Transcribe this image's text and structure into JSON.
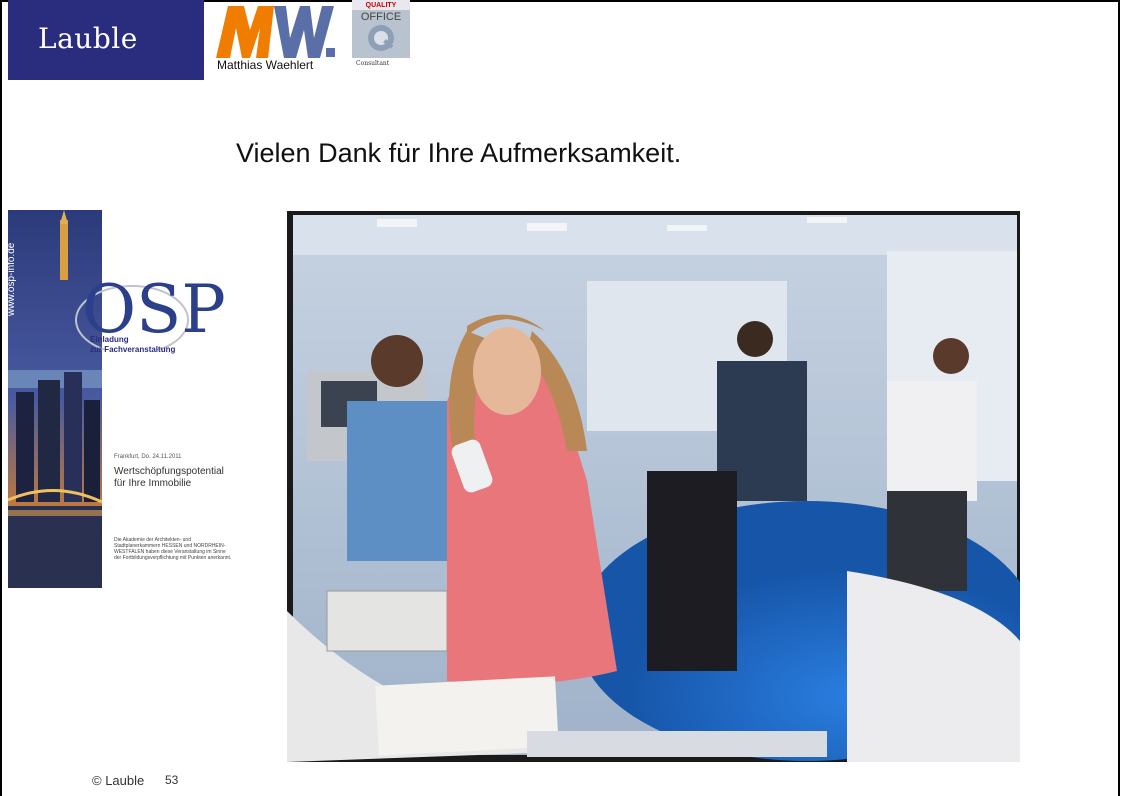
{
  "header": {
    "brand": "Lauble",
    "partner_logo_text": "MW.",
    "partner_caption": "Matthias Waehlert",
    "quality_logo_top": "QUALITY",
    "quality_logo_mid": "OFFICE",
    "quality_logo_caption": "Consultant"
  },
  "main": {
    "headline": "Vielen Dank für Ihre Aufmerksamkeit."
  },
  "flyer": {
    "url": "www.osp-info.de",
    "logo": "OSP",
    "subtitle_1": "Einladung",
    "subtitle_2": "zur Fachveranstaltung",
    "date": "Frankfurt, Do. 24.11.2011",
    "topic_1": "Wertschöpfungspotential",
    "topic_2": "für Ihre Immobilie",
    "body": "Die Akademie der Architekten- und Stadtplanerkammern HESSEN und NORDRHEIN-WESTFALEN haben diese Veranstaltung im Sinne der Fortbildungsverpflichtung mit Punkten anerkannt."
  },
  "footer": {
    "copyright": "© Lauble",
    "page_number": "53"
  },
  "colors": {
    "brand_bar": "#2a2d7e",
    "mw_orange": "#f07d00",
    "mw_blue": "#5a6fa8",
    "carpet_blue": "#1d6fd0",
    "jacket_pink": "#e8767a"
  },
  "icons": {
    "video": "office-callcenter-video-still",
    "flyer_photo": "frankfurt-skyline-photo"
  }
}
